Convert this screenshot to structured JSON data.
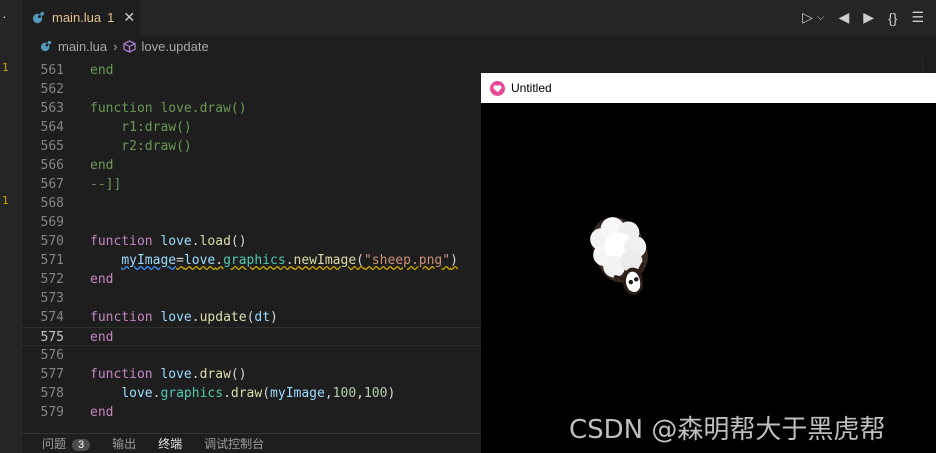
{
  "activity": {
    "menu_glyph": "·",
    "markers": [
      "1",
      "1"
    ]
  },
  "tab": {
    "icon": "lua-file-icon",
    "name": "main.lua",
    "problem_count": "1",
    "close_glyph": "✕"
  },
  "toolbar": {
    "run_glyph": "▷",
    "run_menu_glyph": "⌵",
    "prev_glyph": "◀",
    "next_glyph": "▶",
    "braces_glyph": "{}",
    "list_glyph": "☰"
  },
  "breadcrumb": {
    "file": "main.lua",
    "separator": "›",
    "symbol": "love.update"
  },
  "editor": {
    "current_line": "575",
    "lines": [
      {
        "num": "561",
        "tokens": [
          {
            "t": "end",
            "c": "comment"
          }
        ]
      },
      {
        "num": "562",
        "tokens": []
      },
      {
        "num": "563",
        "tokens": [
          {
            "t": "function love.draw()",
            "c": "comment"
          }
        ]
      },
      {
        "num": "564",
        "tokens": [
          {
            "t": "    r1:draw()",
            "c": "comment"
          }
        ]
      },
      {
        "num": "565",
        "tokens": [
          {
            "t": "    r2:draw()",
            "c": "comment"
          }
        ]
      },
      {
        "num": "566",
        "tokens": [
          {
            "t": "end",
            "c": "comment"
          }
        ]
      },
      {
        "num": "567",
        "tokens": [
          {
            "t": "--]]",
            "c": "comment"
          }
        ]
      },
      {
        "num": "568",
        "tokens": []
      },
      {
        "num": "569",
        "tokens": []
      },
      {
        "num": "570",
        "tokens": [
          {
            "t": "function",
            "c": "kw"
          },
          {
            "t": " ",
            "c": "plain"
          },
          {
            "t": "love",
            "c": "var"
          },
          {
            "t": ".",
            "c": "plain"
          },
          {
            "t": "load",
            "c": "fn"
          },
          {
            "t": "()",
            "c": "plain"
          }
        ]
      },
      {
        "num": "571",
        "tokens": [
          {
            "t": "    ",
            "c": "plain"
          },
          {
            "t": "myImage",
            "c": "var",
            "u": "info"
          },
          {
            "t": "=",
            "c": "plain",
            "u": "warn"
          },
          {
            "t": "love",
            "c": "var",
            "u": "warn"
          },
          {
            "t": ".",
            "c": "plain",
            "u": "warn"
          },
          {
            "t": "graphics",
            "c": "lib",
            "u": "warn"
          },
          {
            "t": ".",
            "c": "plain",
            "u": "warn"
          },
          {
            "t": "newImage",
            "c": "fn",
            "u": "warn"
          },
          {
            "t": "(",
            "c": "plain",
            "u": "warn"
          },
          {
            "t": "\"sheep.png\"",
            "c": "str",
            "u": "warn"
          },
          {
            "t": ")",
            "c": "plain",
            "u": "warn"
          }
        ]
      },
      {
        "num": "572",
        "tokens": [
          {
            "t": "end",
            "c": "kw"
          }
        ]
      },
      {
        "num": "573",
        "tokens": []
      },
      {
        "num": "574",
        "tokens": [
          {
            "t": "function",
            "c": "kw"
          },
          {
            "t": " ",
            "c": "plain"
          },
          {
            "t": "love",
            "c": "var"
          },
          {
            "t": ".",
            "c": "plain"
          },
          {
            "t": "update",
            "c": "fn"
          },
          {
            "t": "(",
            "c": "plain"
          },
          {
            "t": "dt",
            "c": "var"
          },
          {
            "t": ")",
            "c": "plain"
          }
        ]
      },
      {
        "num": "575",
        "tokens": [
          {
            "t": "end",
            "c": "kw"
          }
        ]
      },
      {
        "num": "576",
        "tokens": []
      },
      {
        "num": "577",
        "tokens": [
          {
            "t": "function",
            "c": "kw"
          },
          {
            "t": " ",
            "c": "plain"
          },
          {
            "t": "love",
            "c": "var"
          },
          {
            "t": ".",
            "c": "plain"
          },
          {
            "t": "draw",
            "c": "fn"
          },
          {
            "t": "()",
            "c": "plain"
          }
        ]
      },
      {
        "num": "578",
        "tokens": [
          {
            "t": "    ",
            "c": "plain"
          },
          {
            "t": "love",
            "c": "var"
          },
          {
            "t": ".",
            "c": "plain"
          },
          {
            "t": "graphics",
            "c": "lib"
          },
          {
            "t": ".",
            "c": "plain"
          },
          {
            "t": "draw",
            "c": "fn"
          },
          {
            "t": "(",
            "c": "plain"
          },
          {
            "t": "myImage",
            "c": "var"
          },
          {
            "t": ",",
            "c": "plain"
          },
          {
            "t": "100",
            "c": "num"
          },
          {
            "t": ",",
            "c": "plain"
          },
          {
            "t": "100",
            "c": "num"
          },
          {
            "t": ")",
            "c": "plain"
          }
        ]
      },
      {
        "num": "579",
        "tokens": [
          {
            "t": "end",
            "c": "kw"
          }
        ]
      }
    ]
  },
  "panel": {
    "tabs": [
      {
        "label": "问题",
        "badge": "3"
      },
      {
        "label": "输出"
      },
      {
        "label": "终端",
        "active": true
      },
      {
        "label": "调试控制台"
      }
    ]
  },
  "love_window": {
    "icon": "love-heart-icon",
    "title": "Untitled",
    "sprite": "sheep-sprite"
  },
  "watermark": {
    "text": "CSDN @森明帮大于黑虎帮"
  },
  "colors": {
    "warning": "#cca700",
    "keyword": "#c586c0",
    "function": "#dcdcaa",
    "variable": "#9cdcfe",
    "library": "#4ec9b0",
    "string": "#ce9178",
    "number": "#b5cea8",
    "comment": "#6a9955"
  }
}
